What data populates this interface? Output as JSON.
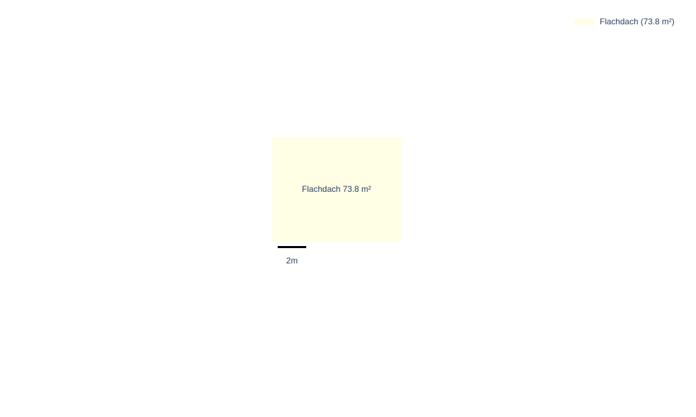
{
  "colors": {
    "roof_fill": "#ffffe6",
    "legend_swatch": "#ffffe0",
    "text": "#2a3f5f",
    "scale_bar": "#000000"
  },
  "legend": {
    "items": [
      {
        "label": "Flachdach (73.8 m²)"
      }
    ]
  },
  "roof": {
    "label": "Flachdach 73.8 m²",
    "type": "Flachdach",
    "area_m2": 73.8
  },
  "scale": {
    "label": "2m",
    "length_m": 2
  }
}
